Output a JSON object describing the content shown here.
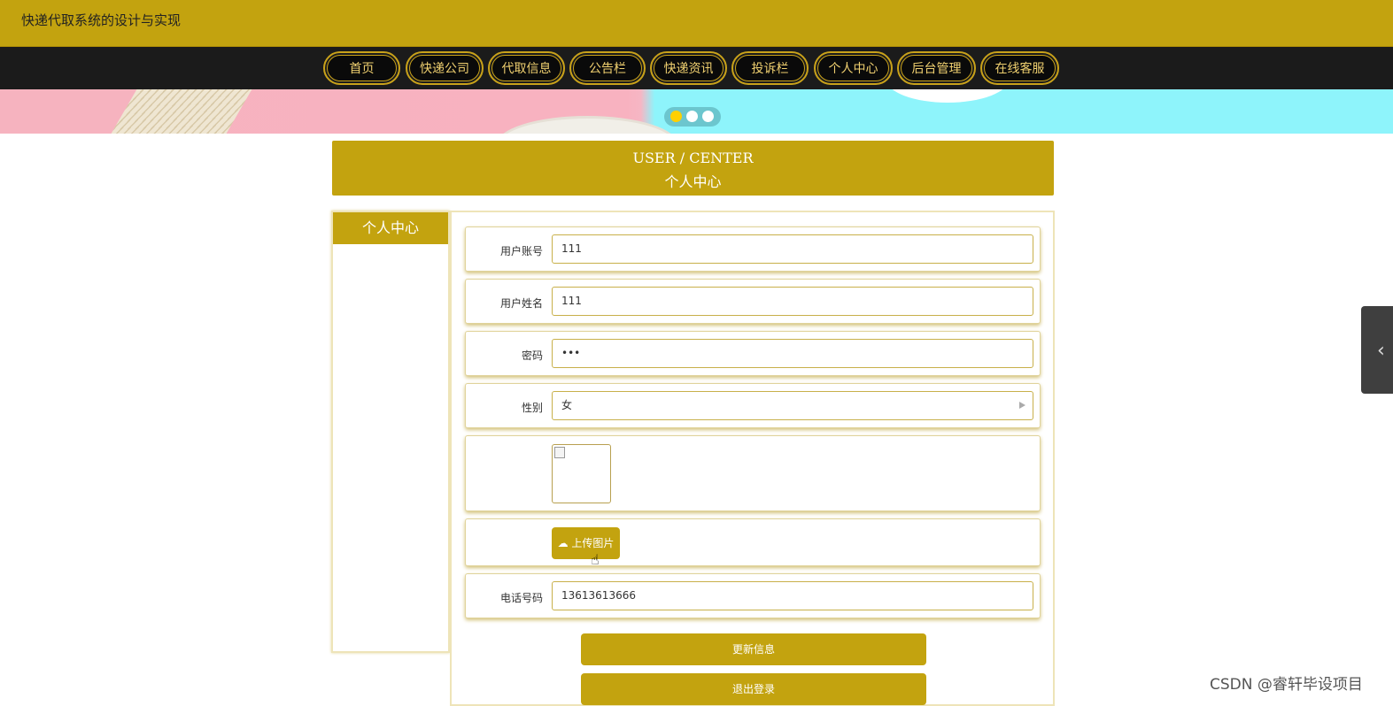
{
  "site": {
    "title": "快递代取系统的设计与实现"
  },
  "nav": {
    "items": [
      "首页",
      "快递公司",
      "代取信息",
      "公告栏",
      "快递资讯",
      "投诉栏",
      "个人中心",
      "后台管理",
      "在线客服"
    ]
  },
  "carousel": {
    "dot_count": 3,
    "active_index": 0
  },
  "header": {
    "title_en": "USER / CENTER",
    "title_zh": "个人中心"
  },
  "sidebar": {
    "title": "个人中心"
  },
  "form": {
    "account_label": "用户账号",
    "account_value": "111",
    "name_label": "用户姓名",
    "name_value": "111",
    "password_label": "密码",
    "password_value": "•••",
    "gender_label": "性别",
    "gender_value": "女",
    "upload_label": "上传图片",
    "phone_label": "电话号码",
    "phone_value": "13613613666"
  },
  "actions": {
    "update": "更新信息",
    "logout": "退出登录"
  },
  "watermark": "CSDN @睿轩毕设项目",
  "colors": {
    "brand": "#c3a30f",
    "nav_bg": "#1b1b1b"
  }
}
